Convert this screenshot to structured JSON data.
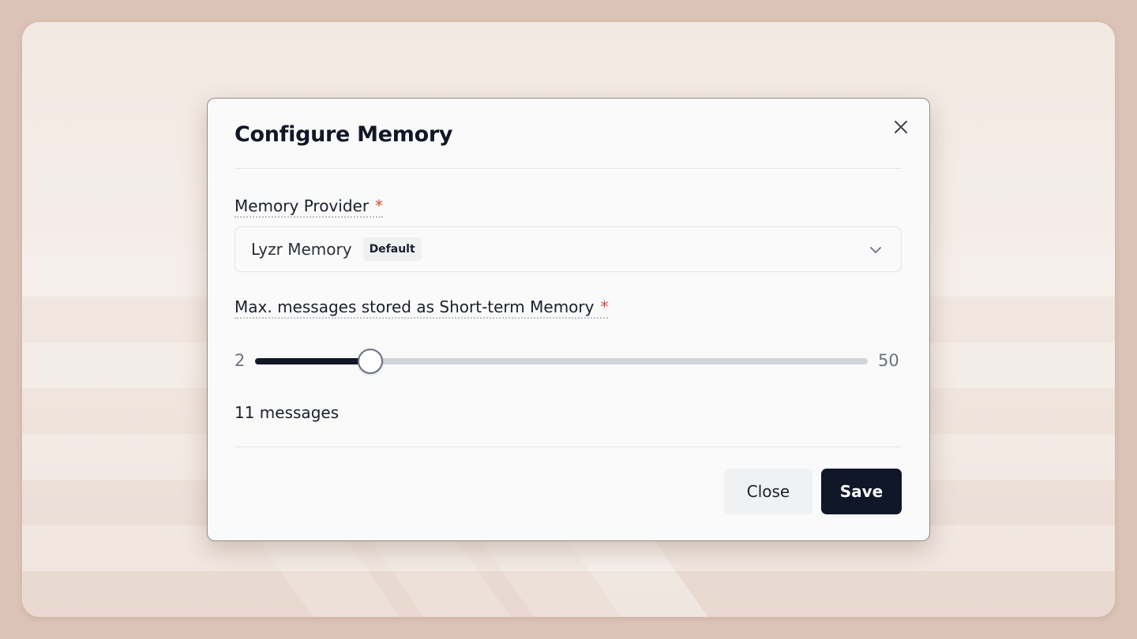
{
  "modal": {
    "title": "Configure Memory",
    "close_icon": "close-icon"
  },
  "memory_provider": {
    "label": "Memory Provider",
    "required_mark": "*",
    "selected_value": "Lyzr Memory",
    "badge": "Default",
    "chevron_icon": "chevron-down-icon"
  },
  "short_term": {
    "label": "Max. messages stored as Short-term Memory",
    "required_mark": "*",
    "slider": {
      "min_label": "2",
      "max_label": "50",
      "min": 2,
      "max": 50,
      "value": 11
    },
    "count_text": "11 messages"
  },
  "actions": {
    "close_label": "Close",
    "save_label": "Save"
  },
  "colors": {
    "accent": "#0f1729",
    "required": "#e0443a",
    "background": "#dcc3b7"
  }
}
